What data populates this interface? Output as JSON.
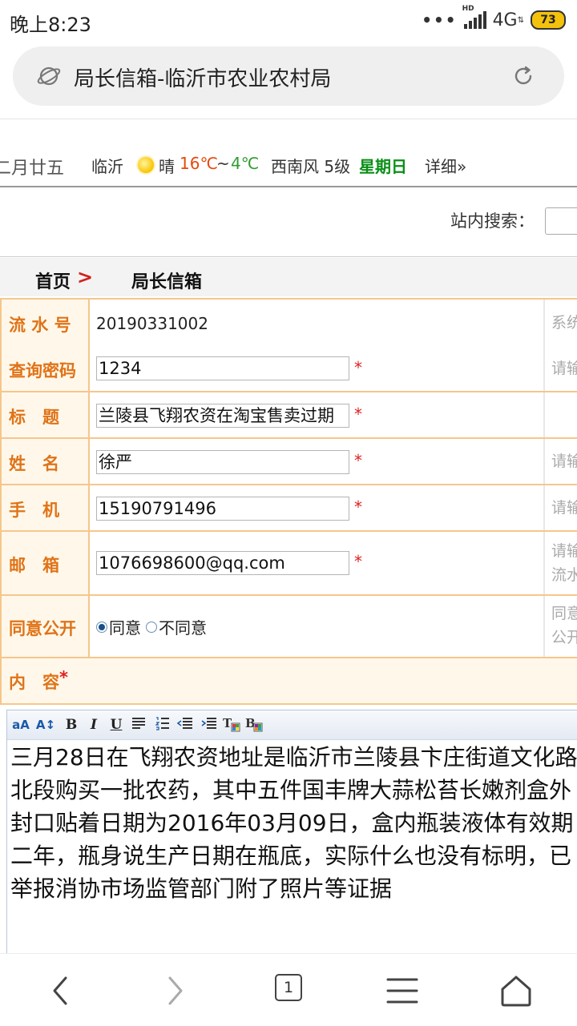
{
  "status_bar": {
    "time": "晚上8:23",
    "hd": "HD",
    "network": "4G",
    "battery": "73",
    "icons": [
      "more-dots-icon",
      "signal-icon",
      "battery-icon"
    ]
  },
  "url_bar": {
    "title": "局长信箱-临沂市农业农村局",
    "icons": [
      "planet-icon",
      "reload-icon"
    ]
  },
  "weather": {
    "lunar_date": "二月廿五",
    "city": "临沂",
    "condition": "晴",
    "high": "16℃",
    "tilde": "~",
    "low": "4℃",
    "wind": "西南风 5级",
    "weekday": "星期日",
    "more": "详细»",
    "colors": {
      "high": "#e8480c",
      "low": "#2f9d2f",
      "weekday": "#0b8f18"
    }
  },
  "search": {
    "label": "站内搜索：",
    "value": ""
  },
  "breadcrumb": {
    "home": "首页",
    "separator": ">",
    "current": "局长信箱"
  },
  "form": {
    "serial": {
      "label": "流 水 号",
      "value": "20190331002",
      "hint": "系统"
    },
    "password": {
      "label": "查询密码",
      "value": "1234",
      "required": "*",
      "hint": "请输"
    },
    "title": {
      "label": "标　题",
      "value": "兰陵县飞翔农资在淘宝售卖过期",
      "required": "*"
    },
    "name": {
      "label": "姓　名",
      "value": "徐严",
      "required": "*",
      "hint": "请输"
    },
    "phone": {
      "label": "手　机",
      "value": "15190791496",
      "required": "*",
      "hint": "请输"
    },
    "email": {
      "label": "邮　箱",
      "value": "1076698600@qq.com",
      "required": "*",
      "hint_line1": "请输",
      "hint_line2": "流水"
    },
    "public": {
      "label": "同意公开",
      "option_agree": "同意",
      "option_disagree": "不同意",
      "selected": "同意",
      "hint_line1": "同意",
      "hint_line2": "公开"
    },
    "content": {
      "label": "内　容",
      "required": "*"
    }
  },
  "editor": {
    "toolbar_icons": [
      "font-family-icon",
      "font-size-icon",
      "bold-icon",
      "italic-icon",
      "underline-icon",
      "align-icon",
      "ordered-list-icon",
      "outdent-icon",
      "indent-icon",
      "text-color-icon",
      "background-color-icon"
    ],
    "bold": "B",
    "italic": "I",
    "underline": "U",
    "text": "三月28日在飞翔农资地址是临沂市兰陵县卞庄街道文化路北段购买一批农药，其中五件国丰牌大蒜松苔长嫩剂盒外封口贴着日期为2016年03月09日，盒内瓶装液体有效期二年，瓶身说生产日期在瓶底，实际什么也没有标明，已举报消协市场监管部门附了照片等证据"
  },
  "bottom_nav": {
    "tab_count": "1",
    "icons": [
      "back-icon",
      "forward-icon",
      "tabs-icon",
      "menu-icon",
      "home-icon"
    ]
  }
}
